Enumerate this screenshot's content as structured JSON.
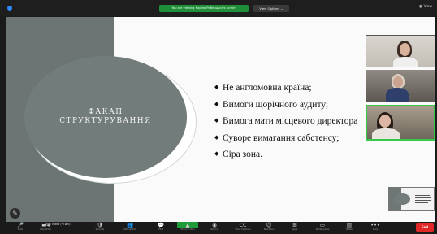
{
  "top_bar": {
    "share_notice": "You are viewing Каріна Рибницька's screen",
    "view_options": "View Options ⌄",
    "view_button": "▦ View"
  },
  "slide": {
    "ellipse_title_line1": "ФАКАП",
    "ellipse_title_line2": "СТРУКТУРУВАННЯ",
    "bullet_marker": "◆",
    "bullets": [
      "Не англомовна країна;",
      "Вимоги щорічного аудиту;",
      "Вимога мати місцевого директора",
      "Суворе вимагання сабстенсу;",
      "Сіра зона."
    ]
  },
  "toolbar": {
    "stop_video_label": "Stop Video (⌥⌘V)",
    "end_label": "End",
    "items": [
      {
        "icon": "microphone-icon",
        "glyph": "🎤",
        "label": "Mute"
      },
      {
        "icon": "video-camera-icon",
        "glyph": "▬◂",
        "label": "Stop Video"
      },
      {
        "icon": "security-icon",
        "glyph": "🛡",
        "label": "Security"
      },
      {
        "icon": "participants-icon",
        "glyph": "👥",
        "label": "Participants"
      },
      {
        "icon": "chat-icon",
        "glyph": "💬",
        "label": "Chat"
      },
      {
        "icon": "share-screen-icon",
        "glyph": "▲",
        "label": "Share Screen"
      },
      {
        "icon": "record-icon",
        "glyph": "◉",
        "label": "Record"
      },
      {
        "icon": "closed-caption-icon",
        "glyph": "CC",
        "label": "Show Captions"
      },
      {
        "icon": "reactions-icon",
        "glyph": "☺",
        "label": "Reactions"
      },
      {
        "icon": "apps-icon",
        "glyph": "⊞",
        "label": "Apps"
      },
      {
        "icon": "whiteboard-icon",
        "glyph": "▭",
        "label": "Whiteboards"
      },
      {
        "icon": "notes-icon",
        "glyph": "▤",
        "label": "Notes"
      },
      {
        "icon": "more-icon",
        "glyph": "•••",
        "label": "More"
      }
    ]
  },
  "colors": {
    "slide_left_panel": "#6d7574",
    "ellipse": "#727c7a",
    "active_speaker_border": "#37c84a",
    "end_button": "#e02828",
    "share_notice": "#1f8f3a"
  }
}
